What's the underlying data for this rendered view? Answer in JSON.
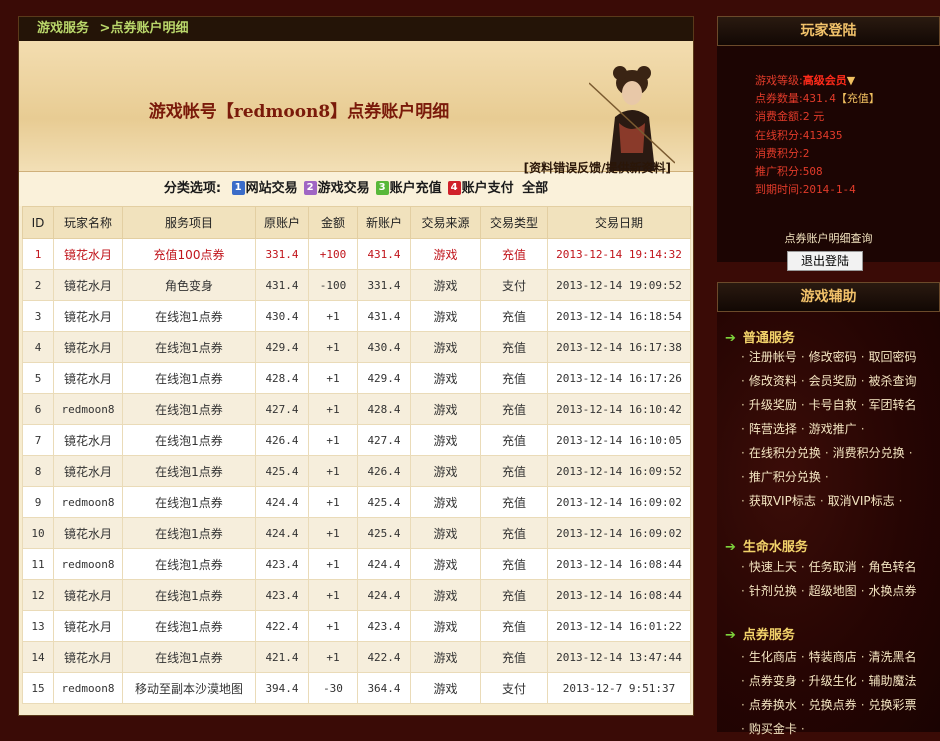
{
  "breadcrumb": {
    "part1": "游戏服务",
    "part2": ">点券账户明细"
  },
  "banner": {
    "title": "游戏帐号【redmoon8】点券账户明细",
    "feedback": "[资料错误反馈/提供新资料]"
  },
  "filter": {
    "label": "分类选项:",
    "items": [
      {
        "num": "1",
        "label": "网站交易",
        "color": "#3b6cc8"
      },
      {
        "num": "2",
        "label": "游戏交易",
        "color": "#a066c4"
      },
      {
        "num": "3",
        "label": "账户充值",
        "color": "#58b83a"
      },
      {
        "num": "4",
        "label": "账户支付",
        "color": "#d0202a"
      }
    ],
    "all": "全部"
  },
  "table": {
    "headers": [
      "ID",
      "玩家名称",
      "服务项目",
      "原账户",
      "金额",
      "新账户",
      "交易来源",
      "交易类型",
      "交易日期"
    ],
    "rows": [
      [
        "1",
        "镜花水月",
        "充值100点券",
        "331.4",
        "+100",
        "431.4",
        "游戏",
        "充值",
        "2013-12-14 19:14:32"
      ],
      [
        "2",
        "镜花水月",
        "角色变身",
        "431.4",
        "-100",
        "331.4",
        "游戏",
        "支付",
        "2013-12-14 19:09:52"
      ],
      [
        "3",
        "镜花水月",
        "在线泡1点券",
        "430.4",
        "+1",
        "431.4",
        "游戏",
        "充值",
        "2013-12-14 16:18:54"
      ],
      [
        "4",
        "镜花水月",
        "在线泡1点券",
        "429.4",
        "+1",
        "430.4",
        "游戏",
        "充值",
        "2013-12-14 16:17:38"
      ],
      [
        "5",
        "镜花水月",
        "在线泡1点券",
        "428.4",
        "+1",
        "429.4",
        "游戏",
        "充值",
        "2013-12-14 16:17:26"
      ],
      [
        "6",
        "redmoon8",
        "在线泡1点券",
        "427.4",
        "+1",
        "428.4",
        "游戏",
        "充值",
        "2013-12-14 16:10:42"
      ],
      [
        "7",
        "镜花水月",
        "在线泡1点券",
        "426.4",
        "+1",
        "427.4",
        "游戏",
        "充值",
        "2013-12-14 16:10:05"
      ],
      [
        "8",
        "镜花水月",
        "在线泡1点券",
        "425.4",
        "+1",
        "426.4",
        "游戏",
        "充值",
        "2013-12-14 16:09:52"
      ],
      [
        "9",
        "redmoon8",
        "在线泡1点券",
        "424.4",
        "+1",
        "425.4",
        "游戏",
        "充值",
        "2013-12-14 16:09:02"
      ],
      [
        "10",
        "镜花水月",
        "在线泡1点券",
        "424.4",
        "+1",
        "425.4",
        "游戏",
        "充值",
        "2013-12-14 16:09:02"
      ],
      [
        "11",
        "redmoon8",
        "在线泡1点券",
        "423.4",
        "+1",
        "424.4",
        "游戏",
        "充值",
        "2013-12-14 16:08:44"
      ],
      [
        "12",
        "镜花水月",
        "在线泡1点券",
        "423.4",
        "+1",
        "424.4",
        "游戏",
        "充值",
        "2013-12-14 16:08:44"
      ],
      [
        "13",
        "镜花水月",
        "在线泡1点券",
        "422.4",
        "+1",
        "423.4",
        "游戏",
        "充值",
        "2013-12-14 16:01:22"
      ],
      [
        "14",
        "镜花水月",
        "在线泡1点券",
        "421.4",
        "+1",
        "422.4",
        "游戏",
        "充值",
        "2013-12-14 13:47:44"
      ],
      [
        "15",
        "redmoon8",
        "移动至副本沙漠地图",
        "394.4",
        "-30",
        "364.4",
        "游戏",
        "支付",
        "2013-12-7 9:51:37"
      ]
    ]
  },
  "login": {
    "title": "玩家登陆",
    "level_label": "游戏等级:",
    "level_value": "高级会员",
    "points_label": "点券数量:",
    "points_value": "431.4",
    "recharge": "【充值】",
    "spent_label": "消费金额:",
    "spent_value": "2 元",
    "online_label": "在线积分:",
    "online_value": "413435",
    "consume_label": "消费积分:",
    "consume_value": "2",
    "promo_label": "推广积分:",
    "promo_value": "508",
    "expiry_label": "到期时间:",
    "expiry_value": "2014-1-4",
    "query_link": "点券账户明细查询",
    "logout_button": "退出登陆"
  },
  "assist": {
    "title": "游戏辅助",
    "sections": [
      {
        "title": "普通服务",
        "lines": [
          [
            "注册帐号",
            "修改密码",
            "取回密码"
          ],
          [
            "修改资料",
            "会员奖励",
            "被杀查询"
          ],
          [
            "升级奖励",
            "卡号自救",
            "军团转名"
          ],
          [
            "阵营选择",
            "游戏推广"
          ],
          [
            "在线积分兑换",
            "消费积分兑换"
          ],
          [
            "推广积分兑换"
          ],
          [
            "获取VIP标志",
            "取消VIP标志"
          ]
        ]
      },
      {
        "title": "生命水服务",
        "lines": [
          [
            "快速上天",
            "任务取消",
            "角色转名"
          ],
          [
            "针剂兑换",
            "超级地图",
            "水换点券"
          ]
        ]
      },
      {
        "title": "点券服务",
        "lines": [
          [
            "生化商店",
            "特装商店",
            "清洗黑名"
          ],
          [
            "点券变身",
            "升级生化",
            "辅助魔法"
          ],
          [
            "点券换水",
            "兑换点券",
            "兑换彩票"
          ],
          [
            "购买金卡"
          ]
        ]
      }
    ]
  }
}
